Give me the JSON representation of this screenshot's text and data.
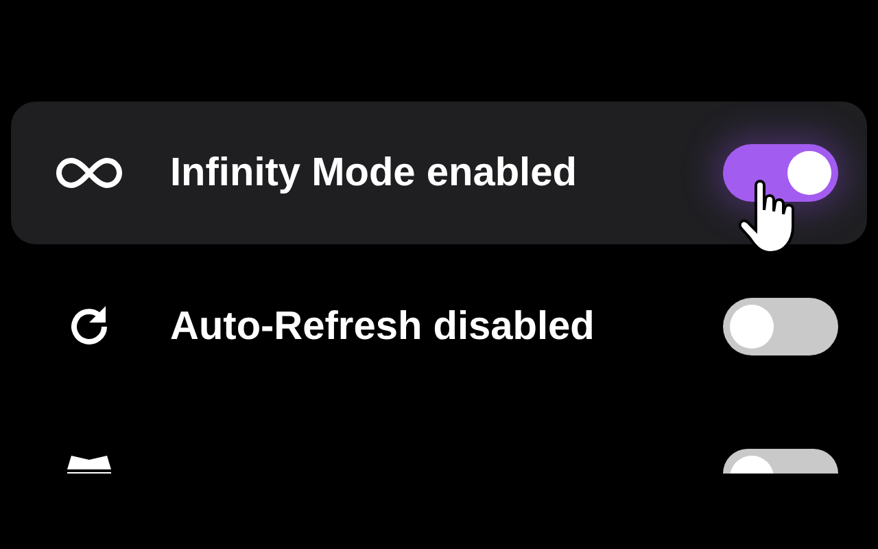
{
  "settings": [
    {
      "label": "Infinity Mode enabled",
      "on": true,
      "selected": true
    },
    {
      "label": "Auto-Refresh disabled",
      "on": false,
      "selected": false
    },
    {
      "on": false,
      "selected": false
    }
  ]
}
